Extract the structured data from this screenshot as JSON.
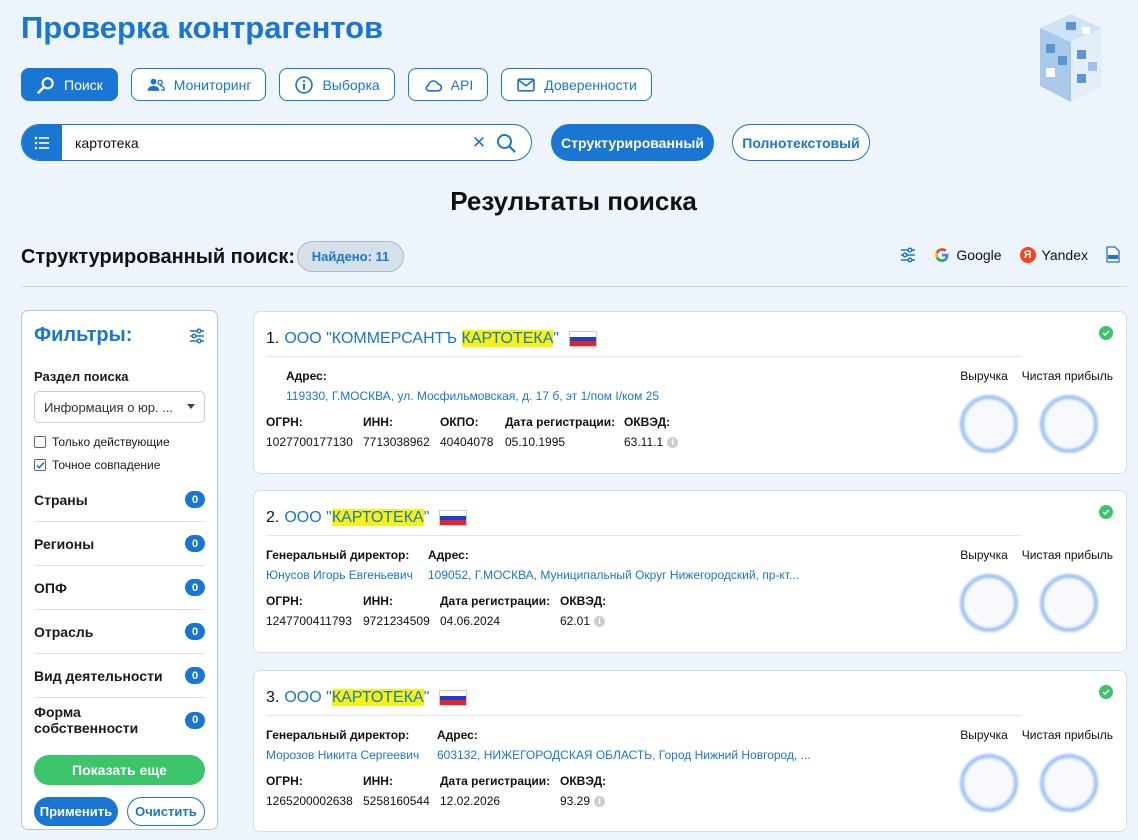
{
  "header": {
    "title": "Проверка контрагентов"
  },
  "nav": [
    {
      "label": "Поиск",
      "icon": "search-icon",
      "active": true
    },
    {
      "label": "Мониторинг",
      "icon": "users-icon",
      "active": false
    },
    {
      "label": "Выборка",
      "icon": "info-icon",
      "active": false
    },
    {
      "label": "API",
      "icon": "cloud-icon",
      "active": false
    },
    {
      "label": "Доверенности",
      "icon": "mail-icon",
      "active": false
    }
  ],
  "search": {
    "value": "картотека",
    "clear_symbol": "✕"
  },
  "modes": {
    "structured": "Структурированный",
    "fulltext": "Полнотекстовый"
  },
  "results": {
    "title": "Результаты поиска",
    "struct_label": "Структурированный поиск:",
    "found": "Найдено: 11"
  },
  "tools": {
    "google": "Google",
    "yandex": "Yandex",
    "yandex_letter": "Я"
  },
  "filters": {
    "title": "Фильтры:",
    "section_label": "Раздел поиска",
    "section_value": "Информация о юр. ...",
    "only_active": "Только действующие",
    "exact_match": "Точное совпадение",
    "rows": [
      {
        "label": "Страны",
        "count": "0"
      },
      {
        "label": "Регионы",
        "count": "0"
      },
      {
        "label": "ОПФ",
        "count": "0"
      },
      {
        "label": "Отрасль",
        "count": "0"
      },
      {
        "label": "Вид деятельности",
        "count": "0"
      },
      {
        "label": "Форма собственности",
        "count": "0"
      }
    ],
    "show_more": "Показать еще",
    "apply": "Применить",
    "clear": "Очистить"
  },
  "finance": {
    "revenue": "Выручка",
    "profit": "Чистая прибыль"
  },
  "labels": {
    "address": "Адрес:",
    "director": "Генеральный директор:",
    "ogrn": "ОГРН:",
    "inn": "ИНН:",
    "okpo": "ОКПО:",
    "reg_date": "Дата регистрации:",
    "okved": "ОКВЭД:"
  },
  "cards": [
    {
      "num": "1.",
      "name_prefix": "ООО \"КОММЕРСАНТЪ ",
      "name_hl": "КАРТОТЕКА",
      "name_suffix": "\"",
      "address": "119330, Г.МОСКВА, ул. Мосфильмовская, д. 17 б, эт 1/пом I/ком 25",
      "ogrn": "1027700177130",
      "inn": "7713038962",
      "okpo": "40404078",
      "reg_date": "05.10.1995",
      "okved": "63.11.1"
    },
    {
      "num": "2.",
      "name_prefix": "ООО \"",
      "name_hl": "КАРТОТЕКА",
      "name_suffix": "\"",
      "director": "Юнусов Игорь Евгеньевич",
      "address": "109052, Г.МОСКВА, Муниципальный Округ Нижегородский, пр-кт...",
      "ogrn": "1247700411793",
      "inn": "9721234509",
      "reg_date": "04.06.2024",
      "okved": "62.01"
    },
    {
      "num": "3.",
      "name_prefix": "ООО \"",
      "name_hl": "КАРТОТЕКА",
      "name_suffix": "\"",
      "director": "Морозов Никита Сергеевич",
      "address": "603132, НИЖЕГОРОДСКАЯ ОБЛАСТЬ, Город Нижний Новгород, ...",
      "ogrn": "1265200002638",
      "inn": "5258160544",
      "reg_date": "12.02.2026",
      "okved": "93.29"
    }
  ]
}
